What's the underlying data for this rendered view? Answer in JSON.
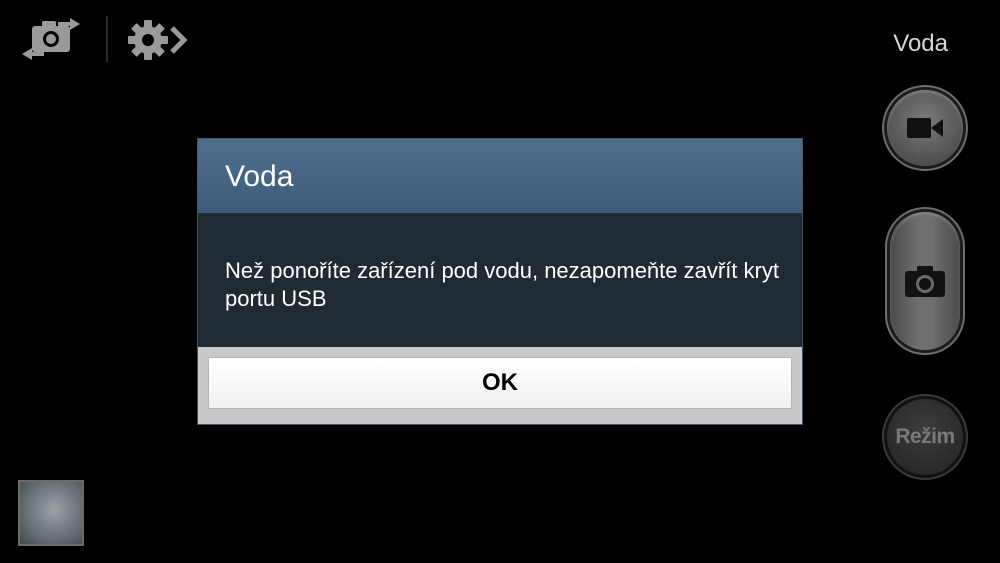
{
  "topbar": {
    "mode_label": "Voda",
    "icons": [
      "switch-camera-icon",
      "settings-icon"
    ]
  },
  "dialog": {
    "title": "Voda",
    "message": "Než ponoříte zařízení pod vodu, nezapomeňte zavřít kryt portu USB",
    "ok_label": "OK"
  },
  "controls": {
    "video_icon": "video-camera-icon",
    "shutter_icon": "camera-icon",
    "mode_button_label": "Režim"
  },
  "colors": {
    "dialog_header": "#45637f",
    "dialog_body": "#1f2a33",
    "button_gray": "#5a5a5a"
  }
}
